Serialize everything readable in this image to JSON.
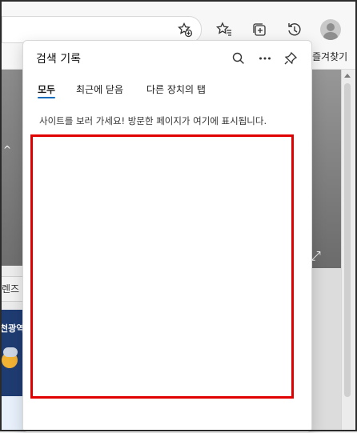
{
  "toolbar": {
    "address_favorite_icon": "star-add-icon",
    "favorites_icon": "favorites-icon",
    "collections_icon": "collections-icon",
    "history_icon": "history-icon",
    "profile_icon": "profile-avatar"
  },
  "favorites_bar": {
    "label": "즐겨찾기"
  },
  "background_page": {
    "tab_fragment": "렌즈 ",
    "weather_fragment": "천광역",
    "expand_icon": "expand-icon"
  },
  "history_panel": {
    "title": "검색 기록",
    "actions": [
      "search-icon",
      "more-icon",
      "pin-icon"
    ],
    "tabs": [
      {
        "label": "모두",
        "active": true
      },
      {
        "label": "최근에 닫음",
        "active": false
      },
      {
        "label": "다른 장치의 탭",
        "active": false
      }
    ],
    "empty_message": "사이트를 보러 가세요! 방문한 페이지가 여기에 표시됩니다.",
    "highlight_color": "#e00000"
  }
}
